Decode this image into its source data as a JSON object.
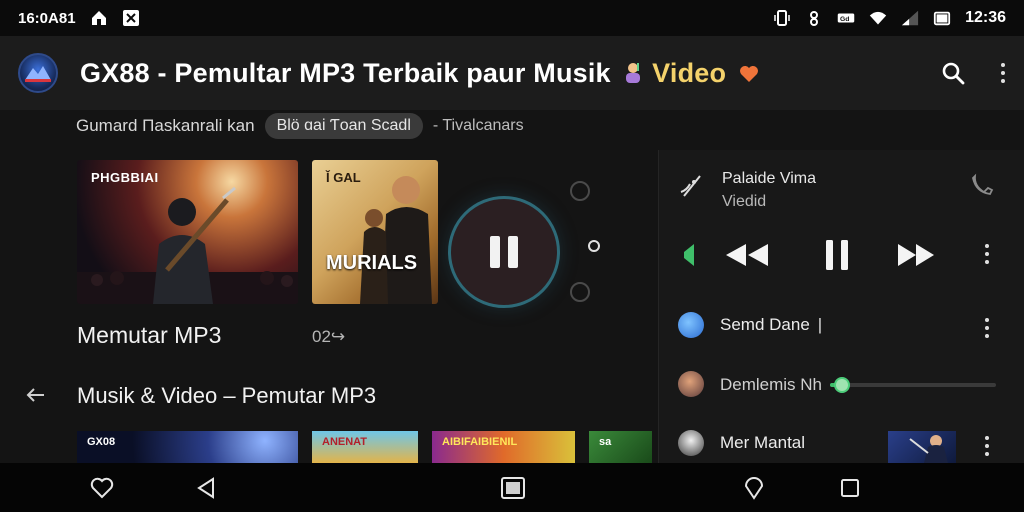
{
  "status_bar": {
    "left_text": "16:0A81",
    "time": "12:36",
    "icons": [
      "home-icon",
      "app-icon",
      "vibrate-icon",
      "settings-icon",
      "battery-saver-icon",
      "wifi-icon",
      "signal-icon",
      "battery-icon"
    ]
  },
  "app_bar": {
    "title": "GX88 - Pemultar MP3 Terbaik paur Musik",
    "title_tail": "Video",
    "icons": [
      "logo-icon",
      "music-emoji-icon",
      "heart-icon",
      "search-icon",
      "more-vert-icon"
    ]
  },
  "tabs": {
    "label": "Gumard Πaskanrali kan",
    "chip": "Blö ɑai Ƭoan Scadl",
    "extra": "- Tivalcanars"
  },
  "featured": {
    "cards": [
      {
        "title": "PHGBBIAI"
      },
      {
        "title": "MURIALS",
        "top_text": "Ǐ GAL"
      }
    ],
    "section_label": "Memutar MP3",
    "count_label": "02↪"
  },
  "section2": {
    "title": "Musik & Video – Pemutar MP3",
    "thumbs": [
      {
        "title": "GX08"
      },
      {
        "title": "ANENAT"
      },
      {
        "title": "AIBIFAIBIENIL"
      },
      {
        "title": "sa"
      }
    ]
  },
  "player": {
    "now_title": "Palaide Vima",
    "now_sub": "Viedid",
    "progress": 0.07,
    "rows": [
      {
        "label": "Semd Dane"
      },
      {
        "label": "Demlemis Nh"
      },
      {
        "label": "Mer Mantal"
      }
    ]
  },
  "colors": {
    "accent_green": "#3fbf6a",
    "ring_teal": "#2e6a78",
    "background": "#141414"
  }
}
